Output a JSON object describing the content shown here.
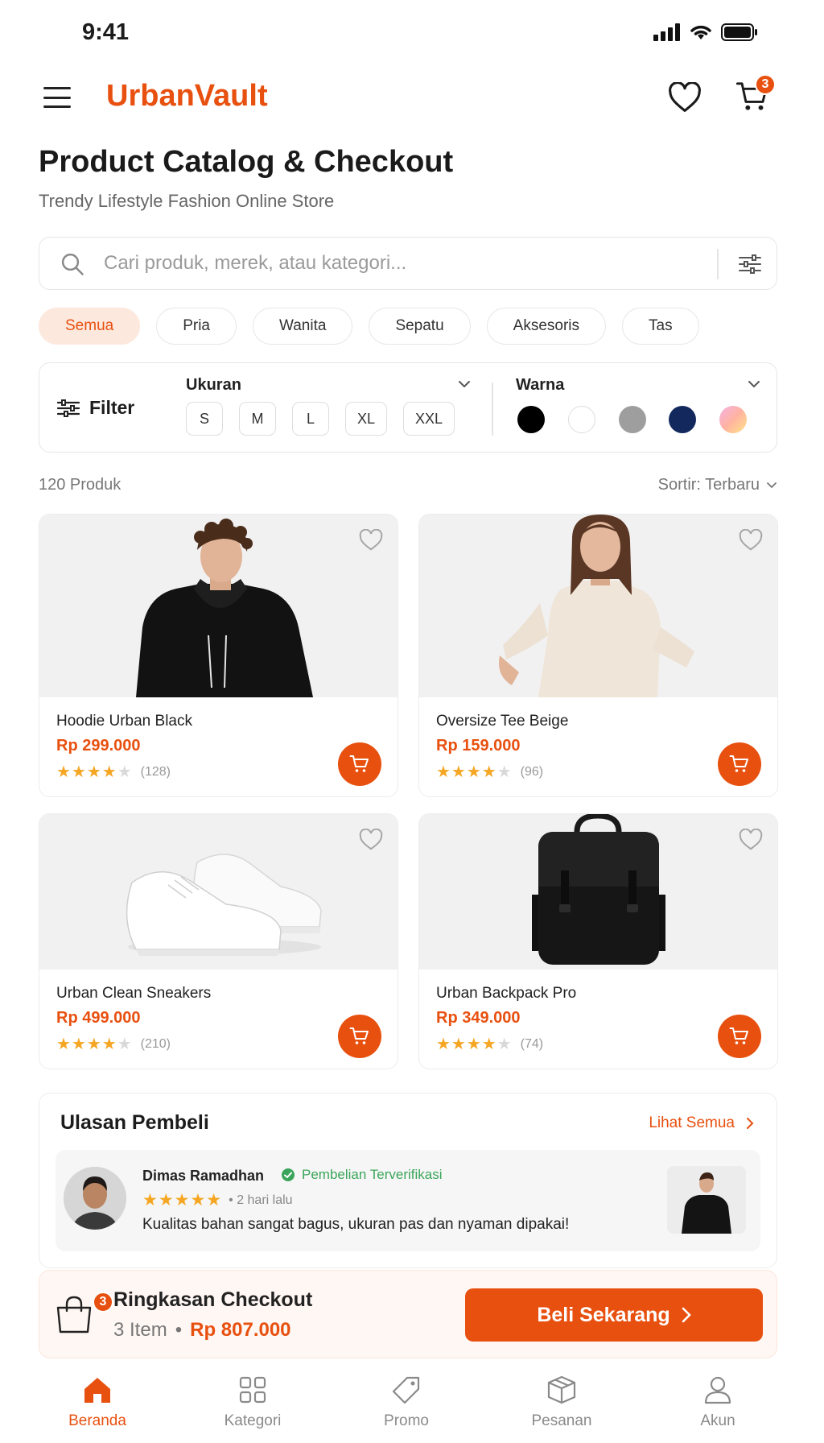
{
  "status_bar": {
    "time": "9:41"
  },
  "header": {
    "brand": "UrbanVault",
    "cart_count": "3"
  },
  "page": {
    "title": "Product Catalog & Checkout",
    "subtitle": "Trendy Lifestyle Fashion Online Store"
  },
  "search": {
    "placeholder": "Cari produk, merek, atau kategori..."
  },
  "categories": [
    "Semua",
    "Pria",
    "Wanita",
    "Sepatu",
    "Aksesoris",
    "Tas"
  ],
  "filter": {
    "label": "Filter",
    "size_title": "Ukuran",
    "sizes": [
      "S",
      "M",
      "L",
      "XL",
      "XXL"
    ],
    "color_title": "Warna",
    "colors": [
      "#000000",
      "#ffffff",
      "#9e9e9e",
      "#13295e",
      "gradient-pink-yellow"
    ]
  },
  "results": {
    "count": "120 Produk",
    "sort": "Sortir: Terbaru"
  },
  "products": [
    {
      "name": "Hoodie Urban Black",
      "price": "Rp 299.000",
      "rating": 4.5,
      "reviews": "(128)"
    },
    {
      "name": "Oversize Tee Beige",
      "price": "Rp 159.000",
      "rating": 4.5,
      "reviews": "(96)"
    },
    {
      "name": "Urban Clean Sneakers",
      "price": "Rp 499.000",
      "rating": 4.5,
      "reviews": "(210)"
    },
    {
      "name": "Urban Backpack Pro",
      "price": "Rp 349.000",
      "rating": 4.5,
      "reviews": "(74)"
    }
  ],
  "reviews": {
    "title": "Ulasan Pembeli",
    "see_all": "Lihat Semua",
    "item": {
      "name": "Dimas Ramadhan",
      "badge": "Pembelian Terverifikasi",
      "rating": 5,
      "time": "• 2 hari lalu",
      "text": "Kualitas bahan sangat bagus, ukuran pas dan nyaman dipakai!"
    }
  },
  "checkout": {
    "title": "Ringkasan Checkout",
    "items": "3 Item",
    "separator": "•",
    "total": "Rp 807.000",
    "badge": "3",
    "button": "Beli Sekarang"
  },
  "bottom_nav": [
    {
      "label": "Beranda",
      "icon": "home-icon"
    },
    {
      "label": "Kategori",
      "icon": "grid-icon"
    },
    {
      "label": "Promo",
      "icon": "tag-icon"
    },
    {
      "label": "Pesanan",
      "icon": "box-icon"
    },
    {
      "label": "Akun",
      "icon": "user-icon"
    }
  ],
  "colors": {
    "accent": "#e8500f",
    "star": "#f5a623",
    "verified": "#3aa55a"
  }
}
